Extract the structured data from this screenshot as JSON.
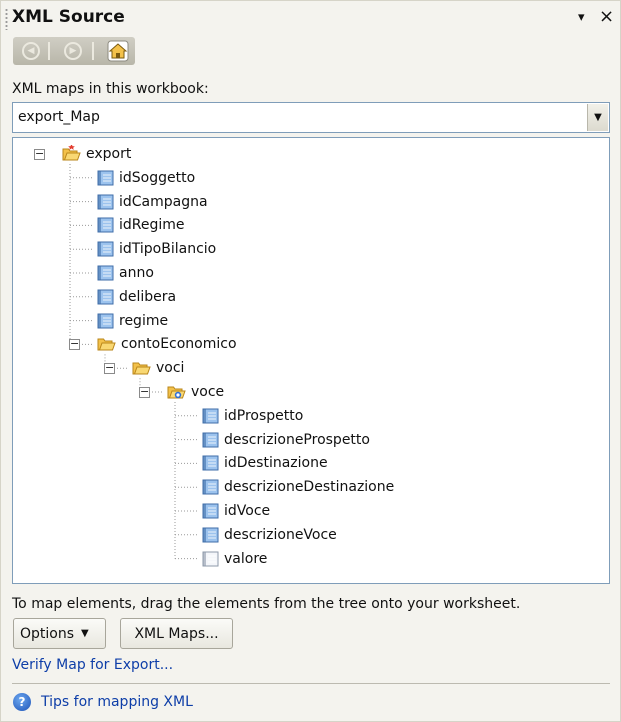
{
  "title": "XML Source",
  "icons": {
    "title_dropdown": "▾",
    "title_close": "×",
    "back": "back-arrow-icon",
    "forward": "forward-arrow-icon",
    "home": "home-icon",
    "help": "help-icon"
  },
  "maps_label": "XML maps in this workbook:",
  "map_select": {
    "value": "export_Map"
  },
  "tree": {
    "nodes": [
      {
        "label": "export",
        "icon": "folder-root"
      },
      {
        "label": "idSoggetto",
        "icon": "element"
      },
      {
        "label": "idCampagna",
        "icon": "element"
      },
      {
        "label": "idRegime",
        "icon": "element"
      },
      {
        "label": "idTipoBilancio",
        "icon": "element"
      },
      {
        "label": "anno",
        "icon": "element"
      },
      {
        "label": "delibera",
        "icon": "element"
      },
      {
        "label": "regime",
        "icon": "element"
      },
      {
        "label": "contoEconomico",
        "icon": "folder"
      },
      {
        "label": "voci",
        "icon": "folder"
      },
      {
        "label": "voce",
        "icon": "folder-repeating"
      },
      {
        "label": "idProspetto",
        "icon": "element"
      },
      {
        "label": "descrizioneProspetto",
        "icon": "element"
      },
      {
        "label": "idDestinazione",
        "icon": "element"
      },
      {
        "label": "descrizioneDestinazione",
        "icon": "element"
      },
      {
        "label": "idVoce",
        "icon": "element"
      },
      {
        "label": "descrizioneVoce",
        "icon": "element"
      },
      {
        "label": "valore",
        "icon": "element-light"
      }
    ]
  },
  "instructions": "To map elements, drag the elements from the tree onto your worksheet.",
  "buttons": {
    "options": "Options",
    "xml_maps": "XML Maps..."
  },
  "verify_link": "Verify Map for Export...",
  "tips_link": "Tips for mapping XML",
  "colors": {
    "pane_bg": "#f4f3ee",
    "link": "#0e3ea8",
    "border": "#7f9db9",
    "folder": "#f3c14a",
    "element_icon": "#9cc3ee"
  }
}
